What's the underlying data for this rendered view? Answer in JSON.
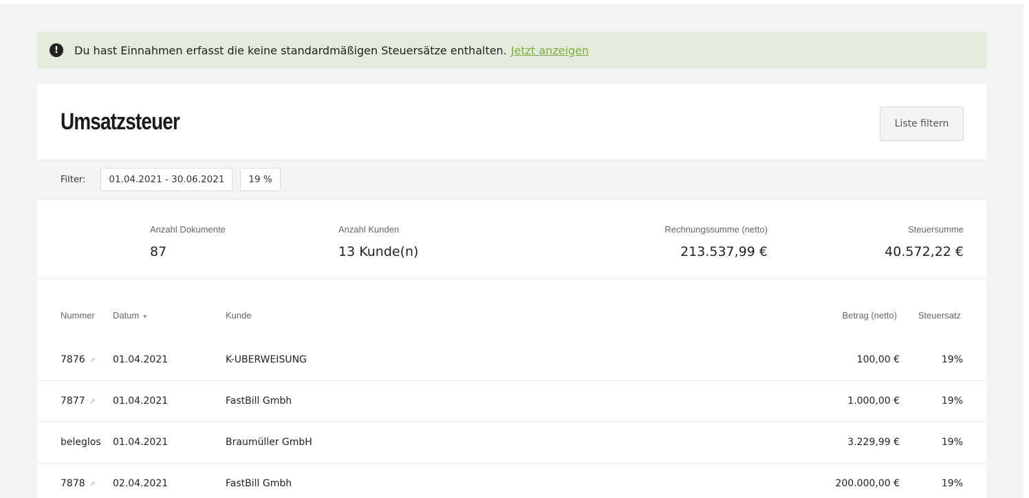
{
  "alert": {
    "icon": "exclamation-icon",
    "text": "Du hast Einnahmen erfasst die keine standardmäßigen Steuersätze enthalten.",
    "link": "Jetzt anzeigen"
  },
  "header": {
    "title": "Umsatzsteuer",
    "filter_button": "Liste filtern"
  },
  "filter": {
    "label": "Filter:",
    "chips": [
      "01.04.2021 - 30.06.2021",
      "19 %"
    ]
  },
  "stats": {
    "documents": {
      "label": "Anzahl Dokumente",
      "value": "87"
    },
    "customers": {
      "label": "Anzahl Kunden",
      "value": "13 Kunde(n)"
    },
    "invoice_sum": {
      "label": "Rechnungssumme (netto)",
      "value": "213.537,99 €"
    },
    "tax_sum": {
      "label": "Steuersumme",
      "value": "40.572,22 €"
    }
  },
  "table": {
    "columns": {
      "nummer": "Nummer",
      "datum": "Datum",
      "kunde": "Kunde",
      "betrag": "Betrag (netto)",
      "steuersatz": "Steuersatz"
    },
    "rows": [
      {
        "nummer": "7876",
        "has_link": true,
        "datum": "01.04.2021",
        "kunde": "K-UBERWEISUNG",
        "betrag": "100,00 €",
        "steuersatz": "19%"
      },
      {
        "nummer": "7877",
        "has_link": true,
        "datum": "01.04.2021",
        "kunde": "FastBill Gmbh",
        "betrag": "1.000,00 €",
        "steuersatz": "19%"
      },
      {
        "nummer": "beleglos",
        "has_link": false,
        "datum": "01.04.2021",
        "kunde": "Braumüller GmbH",
        "betrag": "3.229,99 €",
        "steuersatz": "19%"
      },
      {
        "nummer": "7878",
        "has_link": true,
        "datum": "02.04.2021",
        "kunde": "FastBill Gmbh",
        "betrag": "200.000,00 €",
        "steuersatz": "19%"
      }
    ]
  },
  "colors": {
    "alert_bg": "#e4ebdc",
    "link": "#7fae3a",
    "page_bg": "#f2f3f5"
  }
}
